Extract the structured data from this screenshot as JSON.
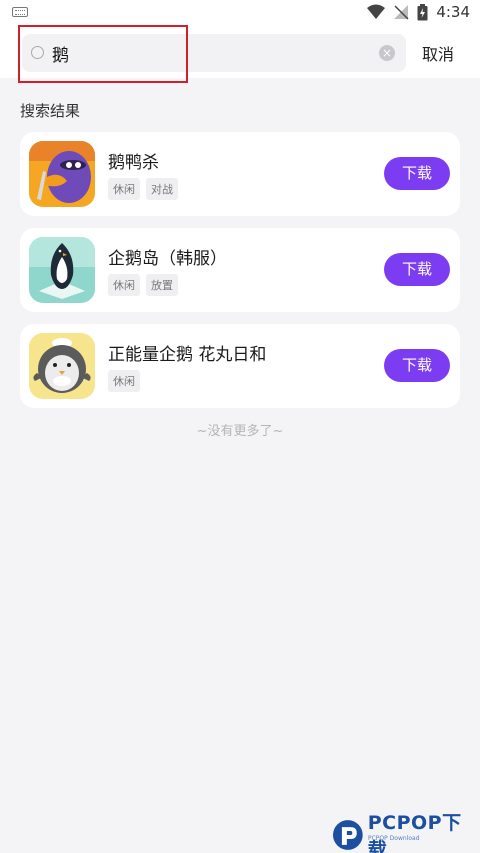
{
  "status_bar": {
    "time": "4:34"
  },
  "search": {
    "query": "鹅",
    "cancel_label": "取消"
  },
  "section_title": "搜索结果",
  "results": [
    {
      "title": "鹅鸭杀",
      "tags": [
        "休闲",
        "对战"
      ],
      "button_label": "下载",
      "icon": "goose-duck-icon"
    },
    {
      "title": "企鹅岛（韩服）",
      "tags": [
        "休闲",
        "放置"
      ],
      "button_label": "下载",
      "icon": "penguin-isle-icon"
    },
    {
      "title": "正能量企鹅 花丸日和",
      "tags": [
        "休闲"
      ],
      "button_label": "下载",
      "icon": "penguin-chef-icon"
    }
  ],
  "end_text": "~没有更多了~",
  "watermark": {
    "text": "PCPOP下载",
    "sub": "PCPOP Download"
  },
  "colors": {
    "accent": "#7b3cf2",
    "highlight": "#d0212a",
    "background": "#f4f4f6"
  }
}
